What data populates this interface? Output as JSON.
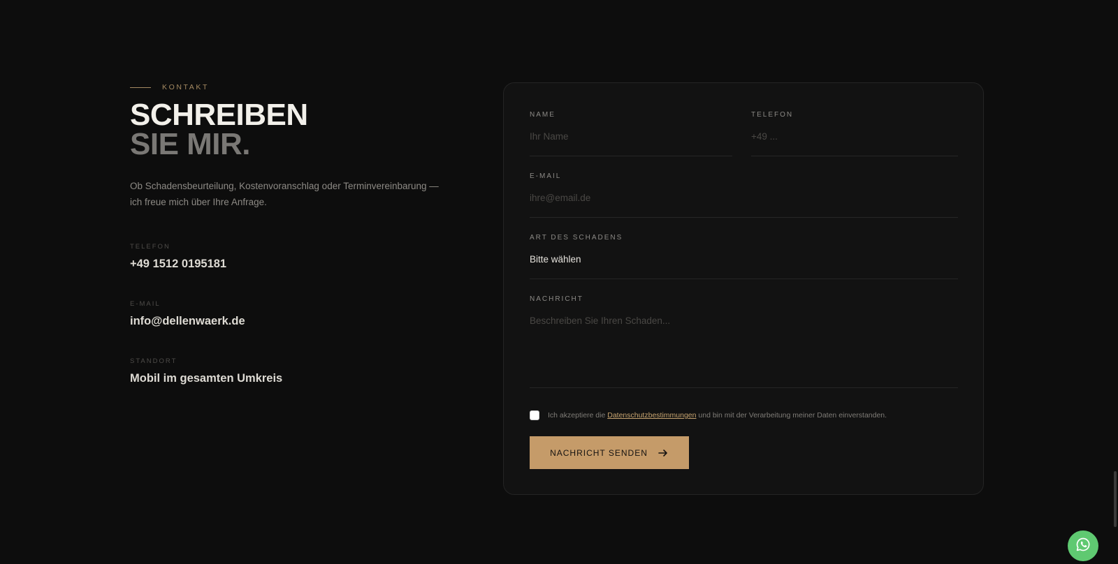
{
  "contact": {
    "eyebrow": "KONTAKT",
    "heading_line1": "SCHREIBEN",
    "heading_line2": "SIE MIR.",
    "intro_line1": "Ob Schadensbeurteilung, Kostenvoranschlag oder Terminvereinbarung —",
    "intro_line2": "ich freue mich über Ihre Anfrage.",
    "items": [
      {
        "label": "TELEFON",
        "value": "+49 1512 0195181"
      },
      {
        "label": "E-MAIL",
        "value": "info@dellenwaerk.de"
      },
      {
        "label": "STANDORT",
        "value": "Mobil im gesamten Umkreis"
      }
    ]
  },
  "form": {
    "name": {
      "label": "NAME",
      "placeholder": "Ihr Name"
    },
    "telefon": {
      "label": "TELEFON",
      "placeholder": "+49 ..."
    },
    "email": {
      "label": "E-MAIL",
      "placeholder": "ihre@email.de"
    },
    "art": {
      "label": "ART DES SCHADENS",
      "value": "Bitte wählen"
    },
    "nachricht": {
      "label": "NACHRICHT",
      "placeholder": "Beschreiben Sie Ihren Schaden..."
    },
    "consent": {
      "prefix": "Ich akzeptiere die",
      "link": "Datenschutzbestimmungen",
      "suffix": "und bin mit der Verarbeitung meiner Daten einverstanden.",
      "checked": false
    },
    "submit_label": "NACHRICHT SENDEN"
  },
  "icons": {
    "submit_icon": "arrow-right-icon",
    "floating_icon": "whatsapp-icon"
  },
  "colors": {
    "accent": "#c59b69",
    "background": "#0d0d0d",
    "whatsapp": "#5fc971"
  }
}
